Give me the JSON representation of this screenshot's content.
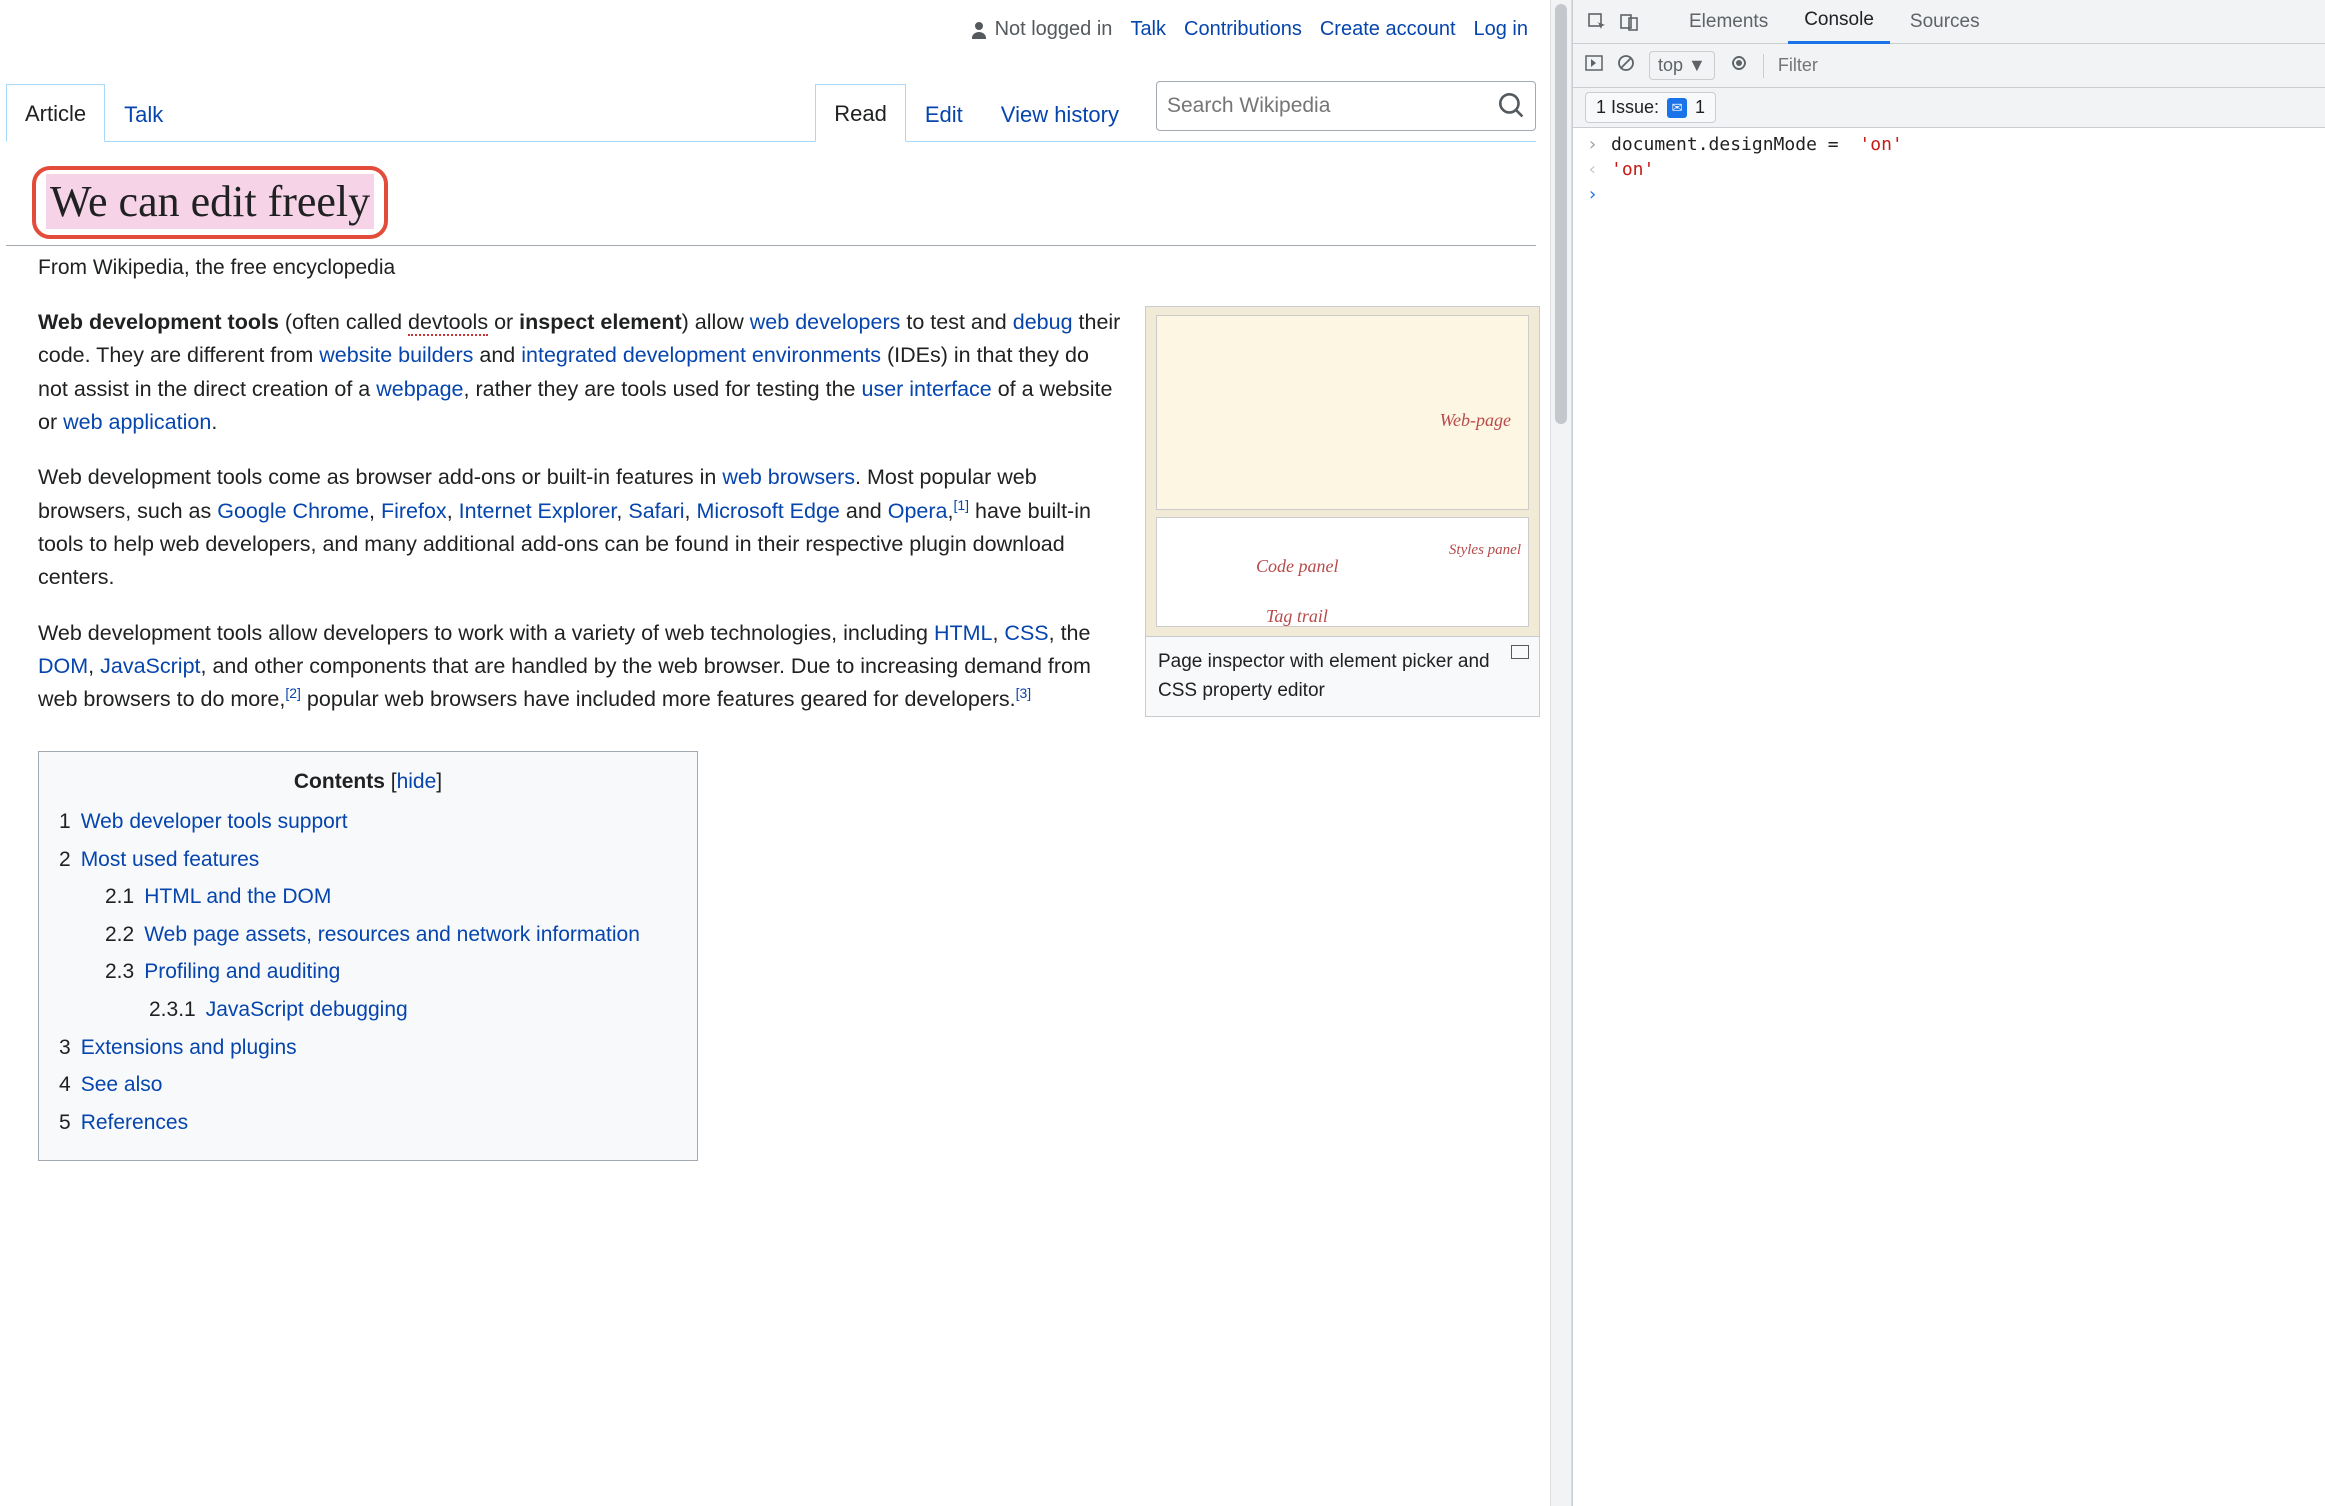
{
  "personalNav": {
    "notLoggedIn": "Not logged in",
    "links": [
      "Talk",
      "Contributions",
      "Create account",
      "Log in"
    ]
  },
  "namespaceTabs": {
    "article": "Article",
    "talk": "Talk"
  },
  "viewTabs": {
    "read": "Read",
    "edit": "Edit",
    "history": "View history"
  },
  "search": {
    "placeholder": "Search Wikipedia"
  },
  "title": "We can edit freely",
  "subtitle": "From Wikipedia, the free encyclopedia",
  "intro": {
    "p1": {
      "t0": "Web development tools",
      "t1": " (often called ",
      "devtools": "devtools",
      "t2": " or ",
      "t3": "inspect element",
      "t4": ") allow ",
      "l_webdev": "web developers",
      "t5": " to test and ",
      "l_debug": "debug",
      "t6": " their code. They are different from ",
      "l_builders": "website builders",
      "t7": " and ",
      "l_ide": "integrated development environments",
      "t8": " (IDEs) in that they do not assist in the direct creation of a ",
      "l_webpage": "webpage",
      "t9": ", rather they are tools used for testing the ",
      "l_ui": "user interface",
      "t10": " of a website or ",
      "l_webapp": "web application",
      "t11": "."
    },
    "p2": {
      "t0": "Web development tools come as browser add-ons or built-in features in ",
      "l_browsers": "web browsers",
      "t1": ". Most popular web browsers, such as ",
      "l_chrome": "Google Chrome",
      "c1": ", ",
      "l_firefox": "Firefox",
      "c2": ", ",
      "l_ie": "Internet Explorer",
      "c3": ", ",
      "l_safari": "Safari",
      "c4": ", ",
      "l_edge": "Microsoft Edge",
      "t2": " and ",
      "l_opera": "Opera",
      "t3": ",",
      "ref1": "[1]",
      "t4": " have built-in tools to help web developers, and many additional add-ons can be found in their respective plugin download centers."
    },
    "p3": {
      "t0": "Web development tools allow developers to work with a variety of web technologies, including ",
      "l_html": "HTML",
      "c1": ", ",
      "l_css": "CSS",
      "t1": ", the ",
      "l_dom": "DOM",
      "c2": ", ",
      "l_js": "JavaScript",
      "t2": ", and other components that are handled by the web browser. Due to increasing demand from web browsers to do more,",
      "ref2": "[2]",
      "t3": " popular web browsers have included more features geared for developers.",
      "ref3": "[3]"
    }
  },
  "infobox": {
    "labels": {
      "webpage": "Web-page",
      "code": "Code panel",
      "styles": "Styles panel",
      "tag": "Tag trail"
    },
    "caption": "Page inspector with element picker and CSS property editor"
  },
  "toc": {
    "title": "Contents",
    "hide": "hide",
    "items": [
      {
        "n": "1",
        "t": "Web developer tools support",
        "lvl": 1
      },
      {
        "n": "2",
        "t": "Most used features",
        "lvl": 1
      },
      {
        "n": "2.1",
        "t": "HTML and the DOM",
        "lvl": 2
      },
      {
        "n": "2.2",
        "t": "Web page assets, resources and network information",
        "lvl": 2
      },
      {
        "n": "2.3",
        "t": "Profiling and auditing",
        "lvl": 2
      },
      {
        "n": "2.3.1",
        "t": "JavaScript debugging",
        "lvl": 3
      },
      {
        "n": "3",
        "t": "Extensions and plugins",
        "lvl": 1
      },
      {
        "n": "4",
        "t": "See also",
        "lvl": 1
      },
      {
        "n": "5",
        "t": "References",
        "lvl": 1
      }
    ]
  },
  "devtools": {
    "tabs": [
      "Elements",
      "Console",
      "Sources"
    ],
    "activeTab": "Console",
    "context": "top ▼",
    "filter": "Filter",
    "issueLabel": "1 Issue:",
    "issueCount": "1",
    "console": {
      "inputLine": "document.designMode = 'on'",
      "outputLine": "'on'"
    }
  }
}
